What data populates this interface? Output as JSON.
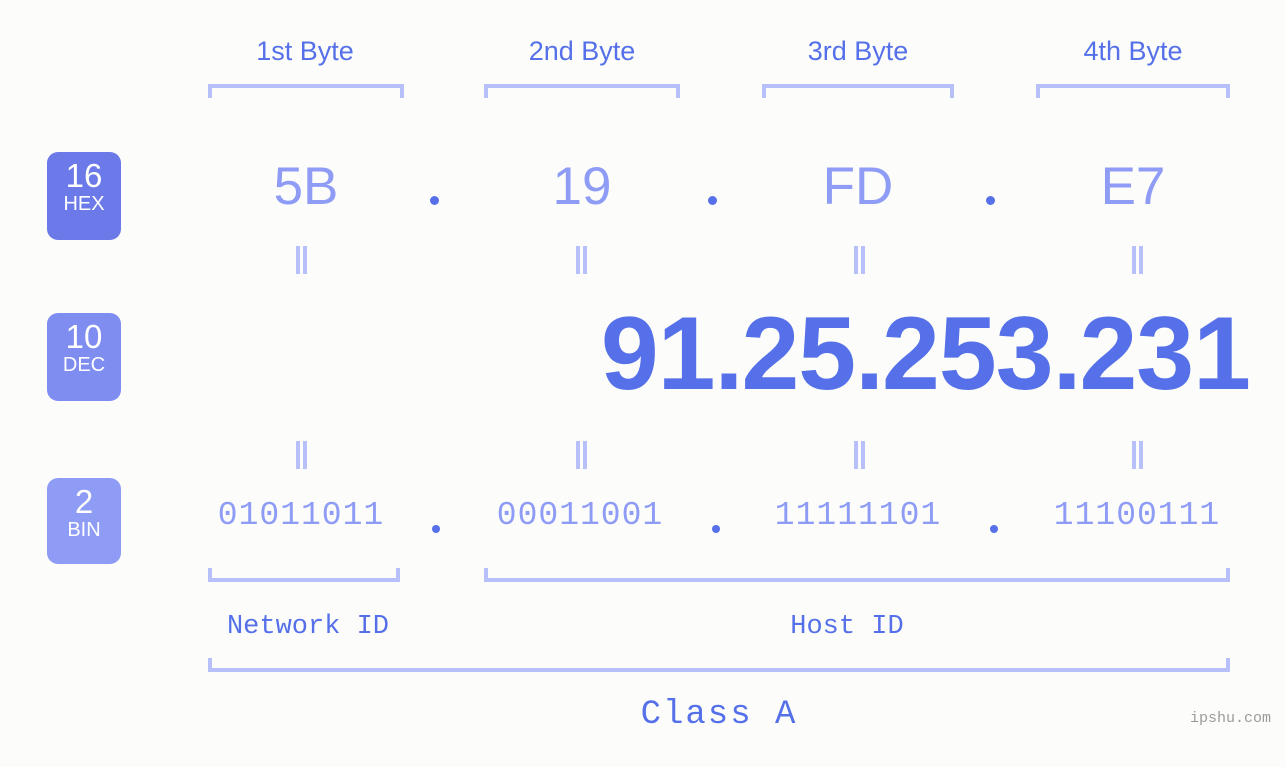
{
  "meta": {
    "background": "#fcfdfa",
    "accent": "#5570e8",
    "accent_light": "#8e9cf5",
    "accent_pale": "#b7c0fa"
  },
  "byte_headers": [
    {
      "label": "1st Byte"
    },
    {
      "label": "2nd Byte"
    },
    {
      "label": "3rd Byte"
    },
    {
      "label": "4th Byte"
    }
  ],
  "bases": [
    {
      "number": "16",
      "name": "HEX",
      "color": "#6b7ae8"
    },
    {
      "number": "10",
      "name": "DEC",
      "color": "#7f8df0"
    },
    {
      "number": "2",
      "name": "BIN",
      "color": "#8e9cf5"
    }
  ],
  "rows": {
    "hex": {
      "values": [
        "5B",
        "19",
        "FD",
        "E7"
      ],
      "separator": "."
    },
    "dec": {
      "values": [
        "91",
        "25",
        "253",
        "231"
      ],
      "separator": ".",
      "full": "91.25.253.231"
    },
    "bin": {
      "values": [
        "01011011",
        "00011001",
        "11111101",
        "11100111"
      ],
      "separator": ".",
      "full": "01011011.00011001.11111101.11100111"
    }
  },
  "equals_mark": "||",
  "segments": {
    "network_id": "Network ID",
    "host_id": "Host ID",
    "class": "Class A"
  },
  "watermark": "ipshu.com"
}
